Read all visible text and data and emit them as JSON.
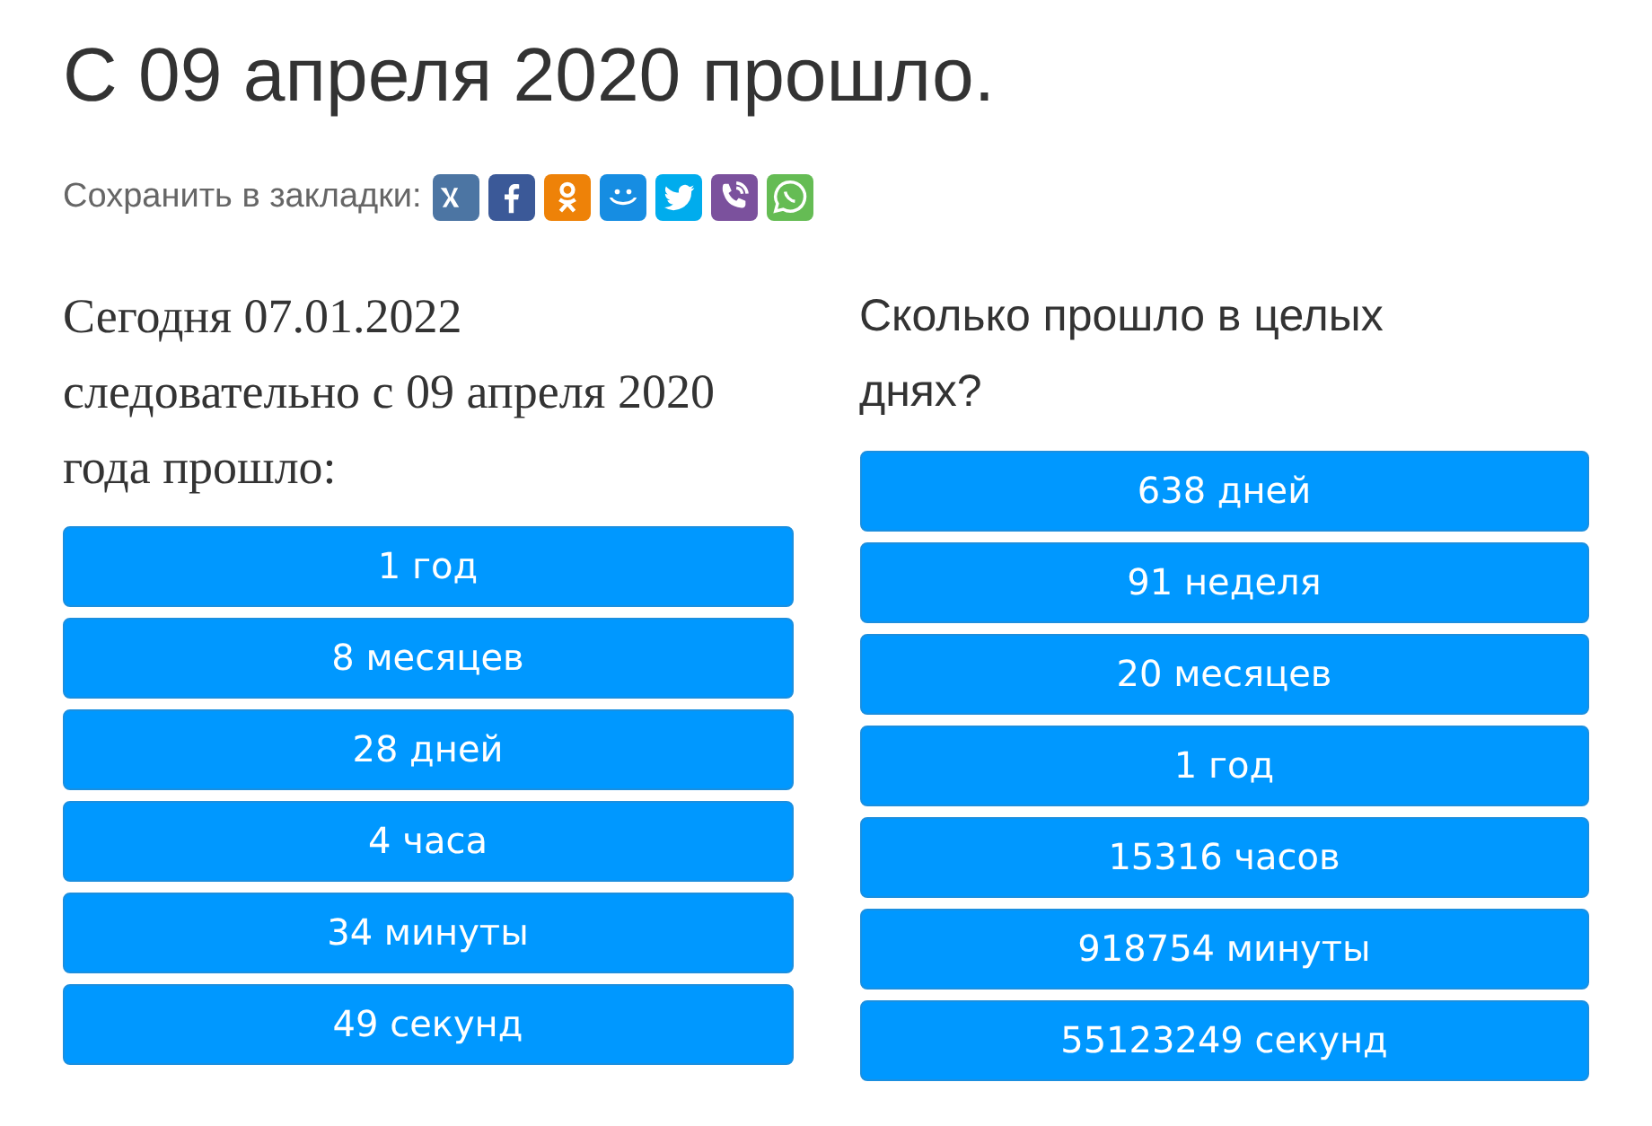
{
  "title": "С 09 апреля 2020 прошло.",
  "bookmarks": {
    "label": "Сохранить в закладки:",
    "share_buttons": [
      {
        "kind": "vk",
        "color": "#4c75a3"
      },
      {
        "kind": "facebook",
        "color": "#3b5998"
      },
      {
        "kind": "ok",
        "color": "#ee8208"
      },
      {
        "kind": "smile",
        "color": "#168de2"
      },
      {
        "kind": "bird",
        "color": "#00aced"
      },
      {
        "kind": "phone",
        "color": "#7b519d"
      },
      {
        "kind": "chat",
        "color": "#65bc54"
      }
    ]
  },
  "left": {
    "text": "Сегодня 07.01.2022 следовательно с 09 апреля 2020 года прошло:",
    "items": [
      "1 год",
      "8 месяцев",
      "28 дней",
      "4 часа",
      "34 минуты",
      "49 секунд"
    ]
  },
  "right": {
    "text": "Сколько прошло в целых днях?",
    "items": [
      "638 дней",
      "91 неделя",
      "20 месяцев",
      "1 год",
      "15316 часов",
      "918754 минуты",
      "55123249 секунд"
    ]
  }
}
